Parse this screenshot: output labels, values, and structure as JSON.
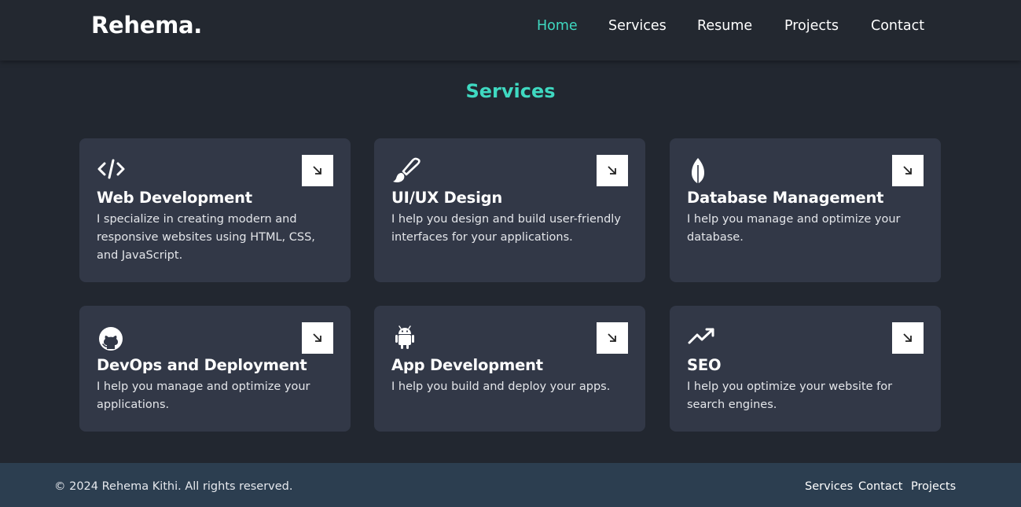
{
  "header": {
    "logo": "Rehema.",
    "nav": [
      {
        "label": "Home",
        "active": true
      },
      {
        "label": "Services",
        "active": false
      },
      {
        "label": "Resume",
        "active": false
      },
      {
        "label": "Projects",
        "active": false
      },
      {
        "label": "Contact",
        "active": false
      }
    ]
  },
  "colors": {
    "accent": "#3fd9c1",
    "background": "#222730",
    "card": "#323847",
    "footer": "#2c3e50"
  },
  "services": {
    "title": "Services",
    "cards": [
      {
        "icon": "code-icon",
        "title": "Web Development",
        "description": "I specialize in creating modern and responsive websites using HTML, CSS, and JavaScript."
      },
      {
        "icon": "paintbrush-icon",
        "title": "UI/UX Design",
        "description": "I help you design and build user-friendly interfaces for your applications."
      },
      {
        "icon": "leaf-icon",
        "title": "Database Management",
        "description": "I help you manage and optimize your database."
      },
      {
        "icon": "github-icon",
        "title": "DevOps and Deployment",
        "description": "I help you manage and optimize your applications."
      },
      {
        "icon": "android-icon",
        "title": "App Development",
        "description": "I help you build and deploy your apps."
      },
      {
        "icon": "trending-up-icon",
        "title": "SEO",
        "description": "I help you optimize your website for search engines."
      }
    ]
  },
  "footer": {
    "copyright": "© 2024 Rehema Kithi. All rights reserved.",
    "links": [
      "Services",
      "Contact",
      "Projects"
    ]
  }
}
